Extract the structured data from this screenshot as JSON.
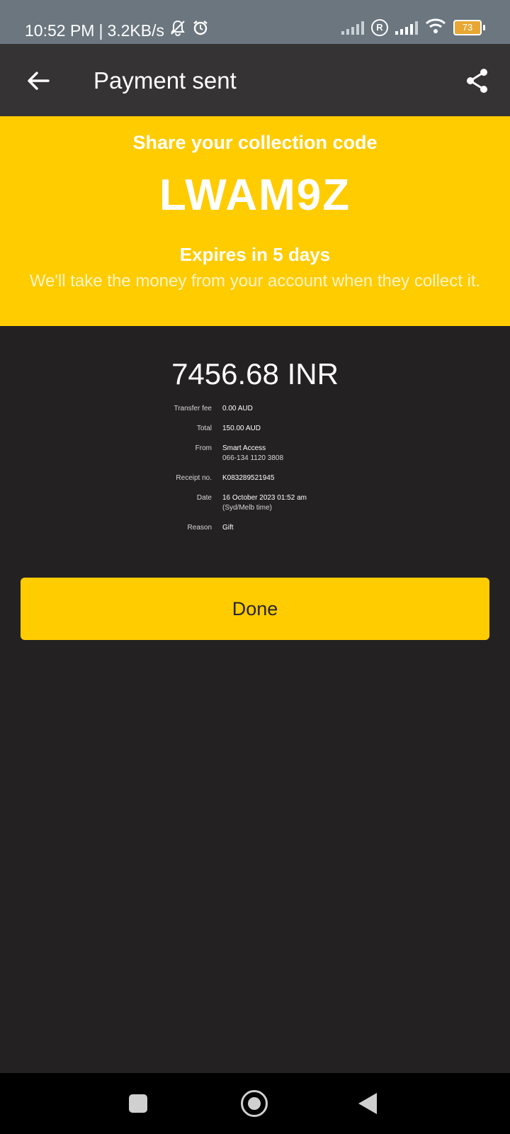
{
  "status_bar": {
    "time": "10:52 PM",
    "separator": "|",
    "speed": "3.2KB/s",
    "battery": "73",
    "icons": [
      "mute-notifications-icon",
      "alarm-icon",
      "signal-icon",
      "roaming-icon",
      "signal-icon",
      "wifi-icon",
      "battery-icon"
    ]
  },
  "app_bar": {
    "title": "Payment sent",
    "icons": [
      "back-arrow-icon",
      "share-icon"
    ]
  },
  "banner": {
    "heading": "Share your collection code",
    "code": "LWAM9Z",
    "expiry": "Expires in 5 days",
    "note": "We'll take the money from your account when they collect it."
  },
  "amount": "7456.68 INR",
  "details": [
    {
      "label": "Transfer fee",
      "value": "0.00 AUD",
      "sub": ""
    },
    {
      "label": "Total",
      "value": "150.00 AUD",
      "sub": ""
    },
    {
      "label": "From",
      "value": "Smart Access",
      "sub": "066-134 1120 3808"
    },
    {
      "label": "Receipt no.",
      "value": "K083289521945",
      "sub": ""
    },
    {
      "label": "Date",
      "value": "16 October 2023 01:52 am",
      "sub": "(Syd/Melb time)"
    },
    {
      "label": "Reason",
      "value": "Gift",
      "sub": ""
    }
  ],
  "done_label": "Done",
  "nav_bar": {
    "icons": [
      "recent-apps-icon",
      "home-icon",
      "back-icon"
    ]
  },
  "colors": {
    "accent": "#ffcc00",
    "background": "#242122",
    "app_bar": "#363335",
    "status_bar": "#6b767f"
  }
}
